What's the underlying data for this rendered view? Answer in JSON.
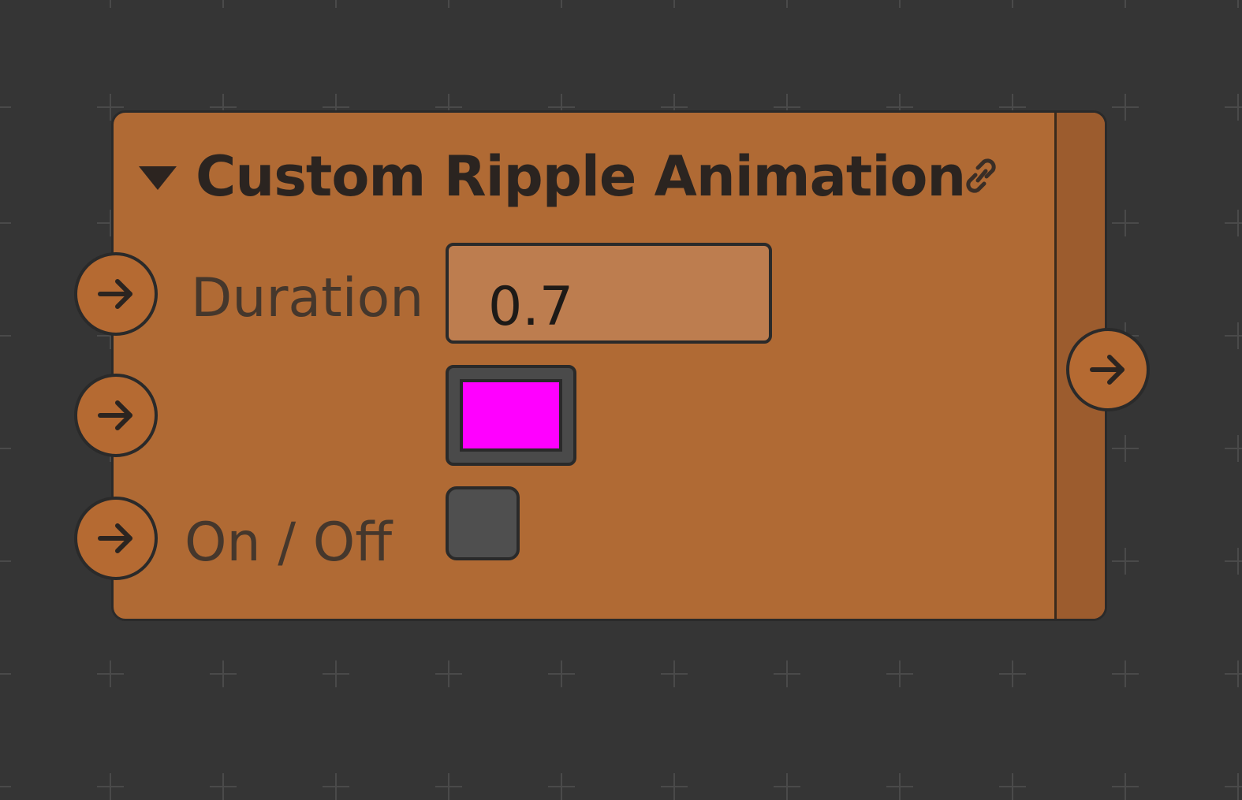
{
  "node": {
    "title": "Custom Ripple Animation",
    "collapse_icon": "triangle-down-icon",
    "link_icon": "link-icon",
    "header_color": "#b06a34",
    "fields": {
      "duration": {
        "label": "Duration",
        "value": "0.7"
      },
      "color": {
        "label": "",
        "value": "#ff00ff"
      },
      "on_off": {
        "label": "On / Off",
        "checked": false
      }
    },
    "ports": {
      "inputs": [
        "arrow-right-icon",
        "arrow-right-icon",
        "arrow-right-icon"
      ],
      "output": "arrow-right-icon"
    }
  },
  "canvas": {
    "background_color": "#353535",
    "grid_color": "#4a4a4a"
  }
}
